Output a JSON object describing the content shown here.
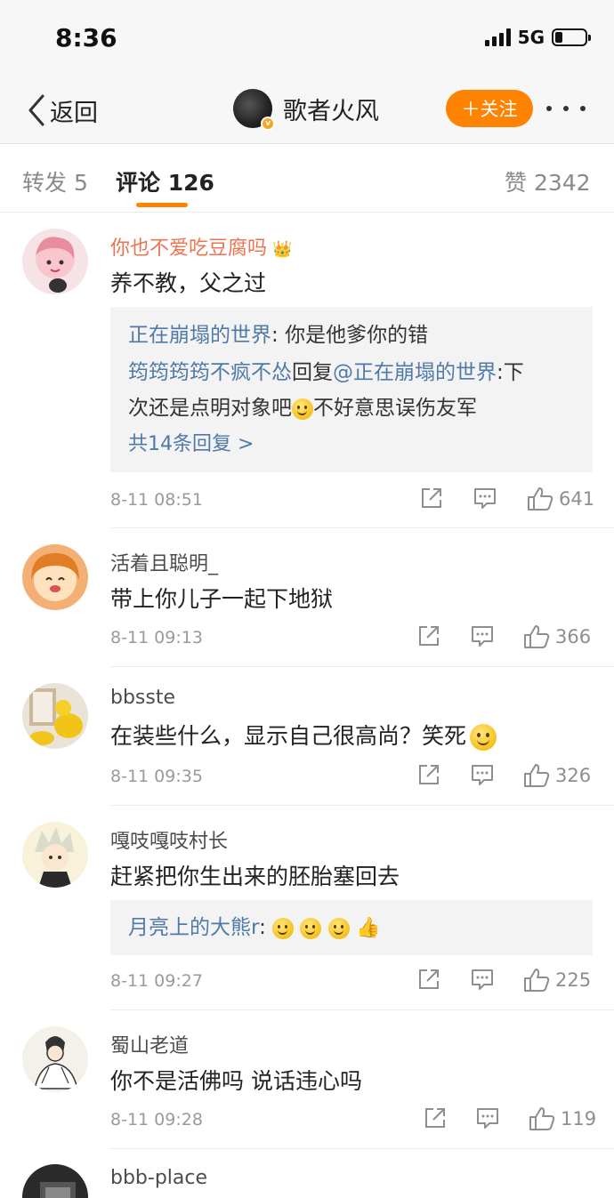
{
  "status_bar": {
    "time": "8:36",
    "network": "5G"
  },
  "nav": {
    "back_label": "返回",
    "profile_name": "歌者火风",
    "follow_label": "＋关注"
  },
  "tabs": {
    "repost": "转发 5",
    "comments": "评论 126",
    "likes": "赞 2342"
  },
  "comments": [
    {
      "user": "你也不爱吃豆腐吗",
      "text": "养不教，父之过",
      "replies": [
        {
          "user": "正在崩塌的世界",
          "sep": ": ",
          "text": "你是他爹你的错"
        },
        {
          "user": "筠筠筠筠不疯不怂",
          "mid": "回复",
          "to": "@正在崩塌的世界",
          "sep": ":",
          "text": "下",
          "text2": "次还是点明对象吧",
          "text3": "不好意思误伤友军"
        }
      ],
      "more": "共14条回复 >",
      "date": "8-11 08:51",
      "likes": "641"
    },
    {
      "user": "活着且聪明_",
      "text": "带上你儿子一起下地狱",
      "date": "8-11 09:13",
      "likes": "366"
    },
    {
      "user": "bbsste",
      "text": "在装些什么，显示自己很高尚？笑死",
      "date": "8-11 09:35",
      "likes": "326"
    },
    {
      "user": "嘎吱嘎吱村长",
      "text": "赶紧把你生出来的胚胎塞回去",
      "replies": [
        {
          "user": "月亮上的大熊r",
          "sep": ": "
        }
      ],
      "date": "8-11 09:27",
      "likes": "225"
    },
    {
      "user": "蜀山老道",
      "text": "你不是活佛吗 说话违心吗",
      "date": "8-11 09:28",
      "likes": "119"
    },
    {
      "user": "bbb-place"
    }
  ],
  "colors": {
    "accent": "#ff8200",
    "link": "#4f7aa8",
    "vip_name": "#eb7350"
  },
  "icons": [
    "back-chevron-icon",
    "verified-badge-icon",
    "more-dots-icon",
    "share-icon",
    "comment-icon",
    "like-icon",
    "crown-icon",
    "smile-emoji-icon",
    "laugh-emoji-icon",
    "thumbs-up-emoji-icon"
  ]
}
